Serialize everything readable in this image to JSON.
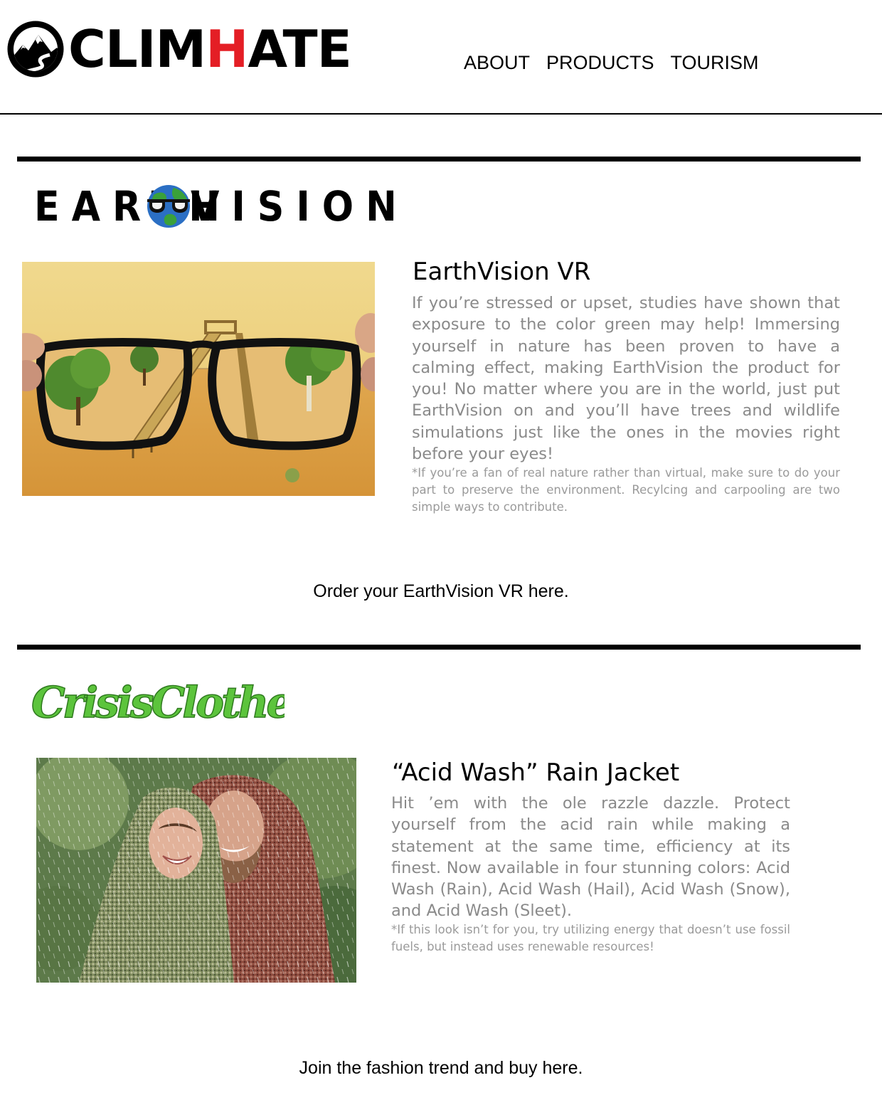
{
  "header": {
    "logo": {
      "text_prefix": "CLIM",
      "text_accent": "H",
      "text_suffix": "ATE",
      "accent_color": "#e41e25"
    },
    "nav": [
      {
        "label": "ABOUT"
      },
      {
        "label": "PRODUCTS"
      },
      {
        "label": "TOURISM"
      }
    ]
  },
  "earthvision": {
    "brand_left": "EARTH",
    "brand_right": "VISION",
    "title": "EarthVision VR",
    "description": "If you’re stressed or upset, studies have shown that exposure to the color green may help! Immersing yourself in nature has been proven to have a calming effect, making EarthVision the product for you! No matter where you are in the world, just put EarthVision on and you’ll have trees and wildlife simulations just like the ones in the movies right before your eyes!",
    "note": "*If you’re a fan of real nature rather than virtual, make sure to do your part to preserve the environment. Recylcing and carpooling are two simple ways to contribute.",
    "cta": "Order your EarthVision VR here."
  },
  "crisisclothes": {
    "brand": "CrisisClothes",
    "brand_color": "#5cc43c",
    "title": "“Acid Wash” Rain Jacket",
    "description": "Hit ’em with the ole razzle dazzle. Protect yourself from the acid rain while making a statement at the same time, efficiency at its finest. Now available in four stunning colors: Acid Wash (Rain), Acid Wash (Hail), Acid Wash (Snow), and Acid Wash (Sleet).",
    "note": "*If this look isn’t for you, try utilizing energy that doesn’t use fossil fuels, but instead uses renewable resources!",
    "cta": "Join the fashion trend and buy here."
  },
  "icons": {
    "logo_mark": "mountain-road-circle-icon",
    "globe": "globe-sunglasses-icon"
  }
}
